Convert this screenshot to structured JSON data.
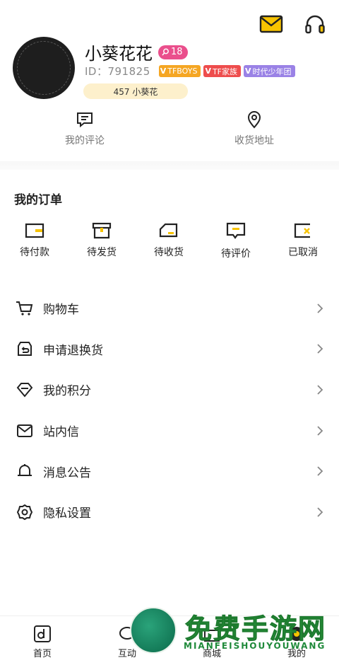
{
  "header": {
    "icons": [
      "mail-icon",
      "headset-icon"
    ]
  },
  "profile": {
    "username": "小葵花花",
    "level": "18",
    "user_id": "ID：791825",
    "badges": [
      {
        "text": "TFBOYS",
        "color": "#f5a623"
      },
      {
        "text": "TF家族",
        "color": "#ee4d4d"
      },
      {
        "text": "时代少年团",
        "color": "#9a82e6"
      }
    ],
    "fan_label": "457 小葵花"
  },
  "quick_actions": [
    {
      "label": "我的评论",
      "icon": "comment-icon"
    },
    {
      "label": "收货地址",
      "icon": "location-pin-icon"
    }
  ],
  "orders": {
    "title": "我的订单",
    "items": [
      {
        "label": "待付款",
        "icon": "wallet-icon"
      },
      {
        "label": "待发货",
        "icon": "box-icon"
      },
      {
        "label": "待收货",
        "icon": "truck-icon"
      },
      {
        "label": "待评价",
        "icon": "review-icon"
      },
      {
        "label": "已取消",
        "icon": "cancelled-icon"
      }
    ]
  },
  "menu": [
    {
      "label": "购物车",
      "icon": "cart-icon"
    },
    {
      "label": "申请退换货",
      "icon": "return-icon"
    },
    {
      "label": "我的积分",
      "icon": "diamond-icon"
    },
    {
      "label": "站内信",
      "icon": "envelope-icon"
    },
    {
      "label": "消息公告",
      "icon": "bell-icon"
    },
    {
      "label": "隐私设置",
      "icon": "settings-icon"
    }
  ],
  "tabbar": [
    {
      "label": "首页",
      "icon": "home-icon"
    },
    {
      "label": "互动",
      "icon": "chat-icon"
    },
    {
      "label": "商城",
      "icon": "shop-icon"
    },
    {
      "label": "我的",
      "icon": "profile-icon"
    }
  ],
  "watermark": {
    "title": "免费手游网",
    "subtitle": "MIANFEISHOUYOUWANG"
  },
  "colors": {
    "accent_yellow": "#f7c300",
    "level_pink": "#ea4f8c",
    "fan_pill": "#fdf0cc"
  }
}
